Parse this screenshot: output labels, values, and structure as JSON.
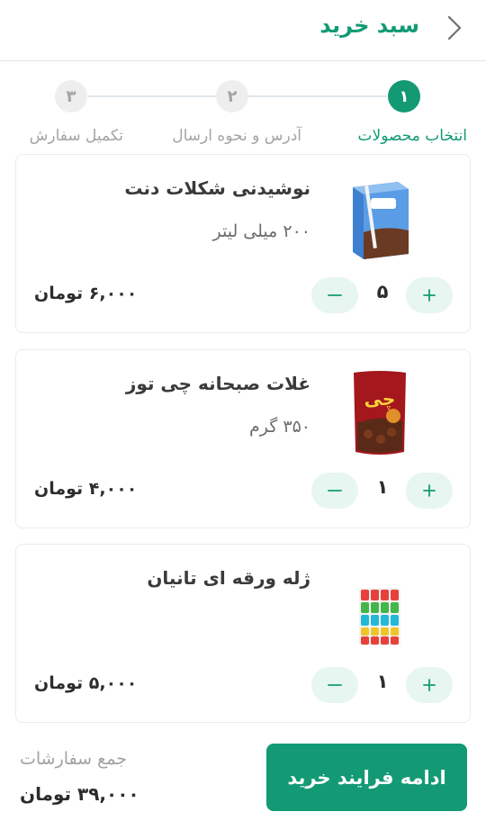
{
  "header": {
    "title": "سبد خرید",
    "back_icon": "chevron-right-icon"
  },
  "stepper": {
    "steps": [
      {
        "number": "۱",
        "label": "انتخاب محصولات",
        "state": "active"
      },
      {
        "number": "۲",
        "label": "آدرس و نحوه ارسال",
        "state": "inactive"
      },
      {
        "number": "۳",
        "label": "تکمیل سفارش",
        "state": "inactive"
      }
    ]
  },
  "cart": {
    "items": [
      {
        "name": "نوشیدنی شکلات دنت",
        "size": "۲۰۰ میلی لیتر",
        "quantity": "۵",
        "price": "۶,۰۰۰ تومان",
        "image": "chocolate-milk-carton"
      },
      {
        "name": "غلات صبحانه چی توز",
        "size": "۳۵۰ گرم",
        "quantity": "۱",
        "price": "۴,۰۰۰ تومان",
        "image": "cereal-bag"
      },
      {
        "name": "ژله ورقه ای تانیان",
        "size": "",
        "quantity": "۱",
        "price": "۵,۰۰۰ تومان",
        "image": "jelly-sheet"
      }
    ]
  },
  "footer": {
    "total_label": "جمع سفارشات",
    "total_value": "۳۹,۰۰۰ تومان",
    "continue_label": "ادامه فرایند خرید"
  },
  "colors": {
    "accent": "#139a74",
    "qty_button_bg": "#e7f6f0",
    "inactive_step": "#a4a4a4"
  }
}
